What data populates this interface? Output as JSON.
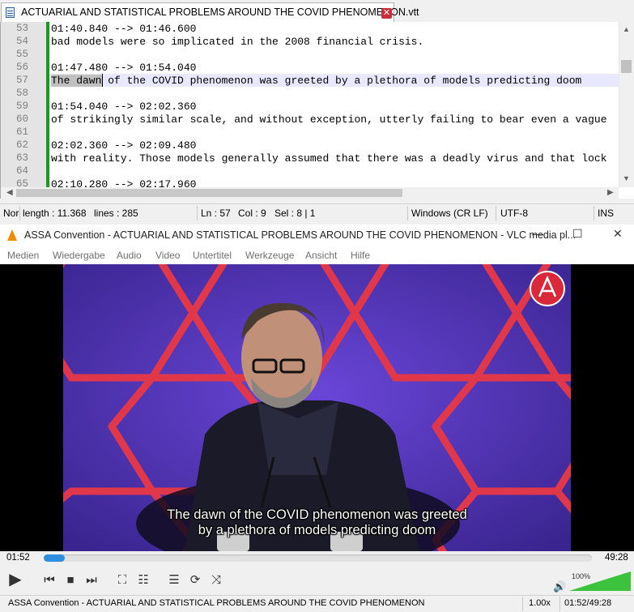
{
  "editor": {
    "tab_title": "ACTUARIAL AND STATISTICAL PROBLEMS AROUND THE COVID PHENOMENON.vtt",
    "tab_close_icon": "close-icon",
    "lines": [
      {
        "num": "53",
        "text": "01:40.840 --> 01:46.600"
      },
      {
        "num": "54",
        "text": "bad models were so implicated in the 2008 financial crisis."
      },
      {
        "num": "55",
        "text": ""
      },
      {
        "num": "56",
        "text": "01:47.480 --> 01:54.040"
      },
      {
        "num": "57",
        "text": "The dawn of the COVID phenomenon was greeted by a plethora of models predicting doom"
      },
      {
        "num": "58",
        "text": ""
      },
      {
        "num": "59",
        "text": "01:54.040 --> 02:02.360"
      },
      {
        "num": "60",
        "text": "of strikingly similar scale, and without exception, utterly failing to bear even a vague"
      },
      {
        "num": "61",
        "text": ""
      },
      {
        "num": "62",
        "text": "02:02.360 --> 02:09.480"
      },
      {
        "num": "63",
        "text": "with reality. Those models generally assumed that there was a deadly virus and that lock"
      },
      {
        "num": "64",
        "text": ""
      },
      {
        "num": "65",
        "text": "02:10.280 --> 02:17.960"
      }
    ],
    "status": {
      "file_type": "Nor",
      "length": "length : 11.368",
      "lines": "lines : 285",
      "ln": "Ln : 57",
      "col": "Col : 9",
      "sel": "Sel : 8 | 1",
      "eol": "Windows (CR LF)",
      "encoding": "UTF-8",
      "mode": "INS"
    }
  },
  "vlc": {
    "title": "ASSA Convention - ACTUARIAL AND STATISTICAL PROBLEMS AROUND THE COVID PHENOMENON - VLC media pl...",
    "window_controls": {
      "minimize": "—",
      "maximize": "☐",
      "close": "✕"
    },
    "menu": [
      "Medien",
      "Wiedergabe",
      "Audio",
      "Video",
      "Untertitel",
      "Werkzeuge",
      "Ansicht",
      "Hilfe"
    ],
    "subtitle_line1": "The dawn of the COVID phenomenon was greeted",
    "subtitle_line2": "by a plethora of models predicting doom",
    "elapsed": "01:52",
    "total": "49:28",
    "progress": 0.038,
    "volume_label": "100%",
    "volume": 1.0,
    "status": {
      "title": "ASSA Convention - ACTUARIAL AND STATISTICAL PROBLEMS AROUND THE COVID PHENOMENON",
      "speed": "1.00x",
      "time": "01:52/49:28"
    },
    "colors": {
      "accent": "#2f8fdf",
      "video_bg": "#4a2fb0",
      "hex_frame": "#e0384a",
      "volume_green": "#3cc23c"
    }
  }
}
